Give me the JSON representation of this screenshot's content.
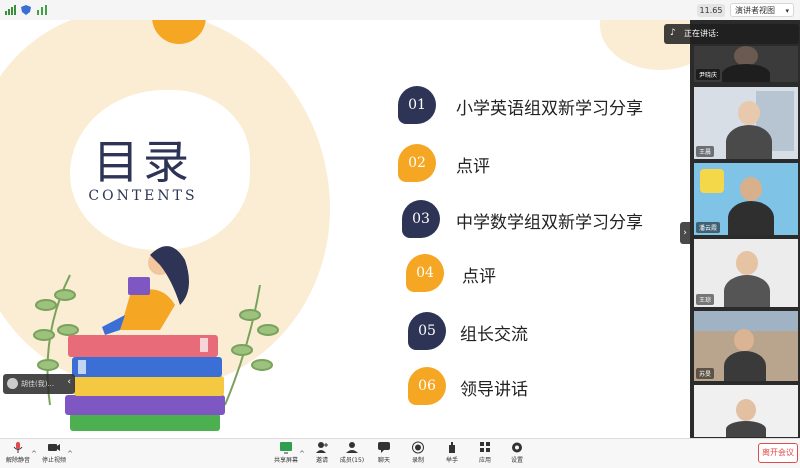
{
  "topbar": {
    "network_label": "11.65",
    "view_label": "演讲者视图"
  },
  "slide": {
    "title": "目录",
    "subtitle": "CONTENTS",
    "colors": {
      "navy": "#2d3455",
      "orange": "#f5a623",
      "cream": "#fbedd4"
    },
    "toc": [
      {
        "num": "01",
        "text": "小学英语组双新学习分享",
        "color": "navy"
      },
      {
        "num": "02",
        "text": "点评",
        "color": "orange"
      },
      {
        "num": "03",
        "text": "中学数学组双新学习分享",
        "color": "navy"
      },
      {
        "num": "04",
        "text": "点评",
        "color": "orange"
      },
      {
        "num": "05",
        "text": "组长交流",
        "color": "navy"
      },
      {
        "num": "06",
        "text": "领导讲话",
        "color": "orange"
      }
    ]
  },
  "speaker_bar": {
    "label": "正在讲话:"
  },
  "participants": [
    {
      "name": "尹晓庆"
    },
    {
      "name": "王晨"
    },
    {
      "name": "潘云霞"
    },
    {
      "name": "王琼"
    },
    {
      "name": "苏旻"
    },
    {
      "name": ""
    }
  ],
  "mini_window": {
    "label": "胡佳(我)..."
  },
  "toolbar": {
    "left": [
      {
        "label": "解除静音",
        "icon": "mic-icon"
      },
      {
        "label": "停止视频",
        "icon": "camera-icon"
      }
    ],
    "center": [
      {
        "label": "共享屏幕",
        "icon": "share-screen-icon"
      },
      {
        "label": "邀请",
        "icon": "invite-icon"
      },
      {
        "label": "成员(15)",
        "icon": "members-icon"
      },
      {
        "label": "聊天",
        "icon": "chat-icon"
      },
      {
        "label": "录制",
        "icon": "record-icon"
      },
      {
        "label": "举手",
        "icon": "raise-hand-icon"
      },
      {
        "label": "应用",
        "icon": "apps-icon"
      },
      {
        "label": "设置",
        "icon": "settings-icon"
      }
    ],
    "leave_label": "离开会议"
  }
}
